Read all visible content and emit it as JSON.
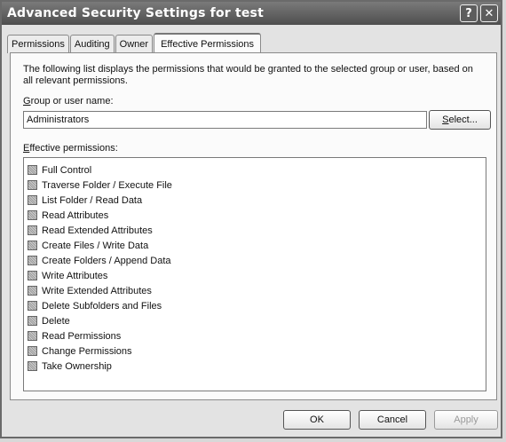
{
  "window": {
    "title": "Advanced Security Settings for test",
    "help_glyph": "?",
    "close_glyph": "✕"
  },
  "tabs": [
    {
      "label": "Permissions"
    },
    {
      "label": "Auditing"
    },
    {
      "label": "Owner"
    },
    {
      "label": "Effective Permissions",
      "active": true
    }
  ],
  "panel": {
    "intro": "The following list displays the permissions that would be granted to the selected group or user, based on all relevant permissions.",
    "group_label_accel": "G",
    "group_label_rest": "roup or user name:",
    "group_value": "Administrators",
    "select_accel": "S",
    "select_rest": "elect...",
    "effective_label_accel": "E",
    "effective_label_rest": "ffective permissions:",
    "permissions": [
      "Full Control",
      "Traverse Folder / Execute File",
      "List Folder / Read Data",
      "Read Attributes",
      "Read Extended Attributes",
      "Create Files / Write Data",
      "Create Folders / Append Data",
      "Write Attributes",
      "Write Extended Attributes",
      "Delete Subfolders and Files",
      "Delete",
      "Read Permissions",
      "Change Permissions",
      "Take Ownership"
    ]
  },
  "buttons": {
    "ok": "OK",
    "cancel": "Cancel",
    "apply": "Apply"
  }
}
